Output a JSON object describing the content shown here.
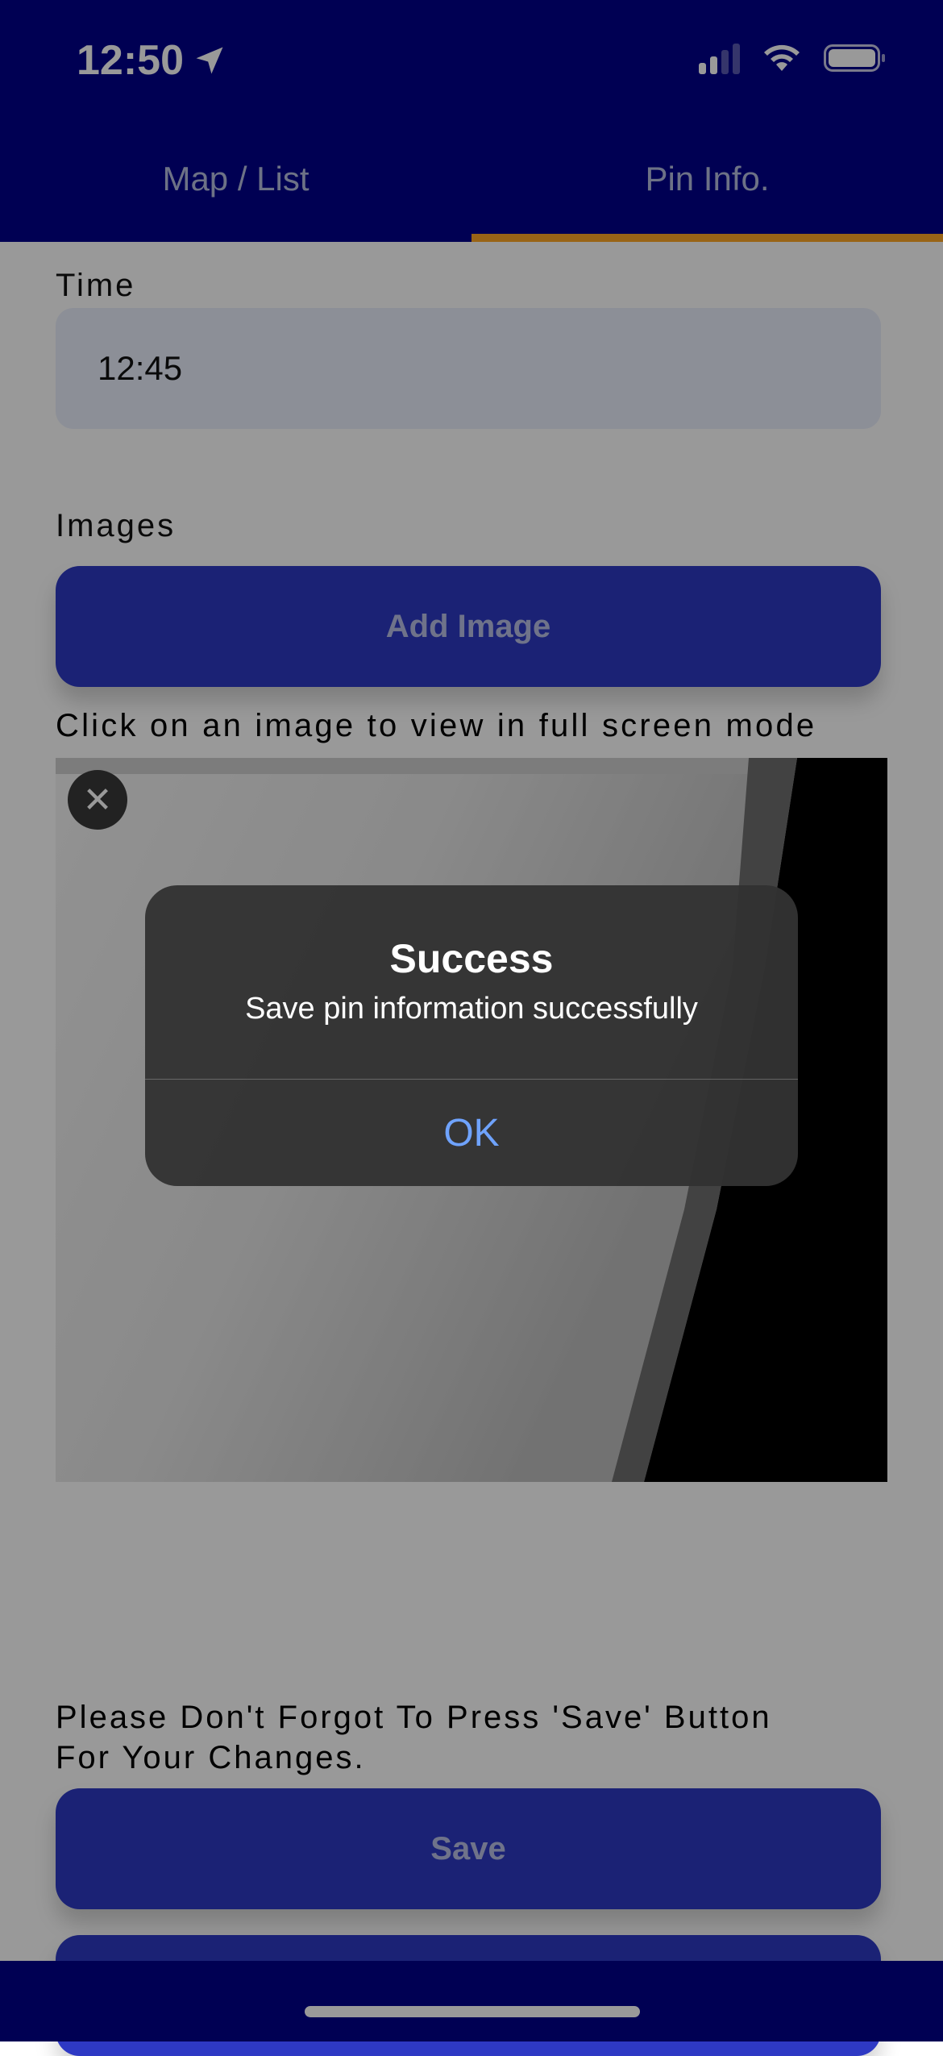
{
  "status_bar": {
    "time": "12:50"
  },
  "tabs": [
    {
      "label": "Map / List",
      "active": false
    },
    {
      "label": "Pin Info.",
      "active": true
    }
  ],
  "form": {
    "time_label": "Time",
    "time_value": "12:45",
    "images_label": "Images",
    "add_image_button": "Add Image",
    "image_hint": "Click on an image to view in full screen mode",
    "remove_image_symbol": "✕",
    "reminder_line1": "Please Don't Forgot To Press 'Save' Button",
    "reminder_line2": "For Your Changes.",
    "save_button": "Save"
  },
  "dialog": {
    "title": "Success",
    "message": "Save pin information successfully",
    "ok_label": "OK"
  },
  "colors": {
    "header": "#00008b",
    "tab_indicator": "#ffa726",
    "button": "#2e39c4",
    "ok_text": "#6fa3ff"
  }
}
